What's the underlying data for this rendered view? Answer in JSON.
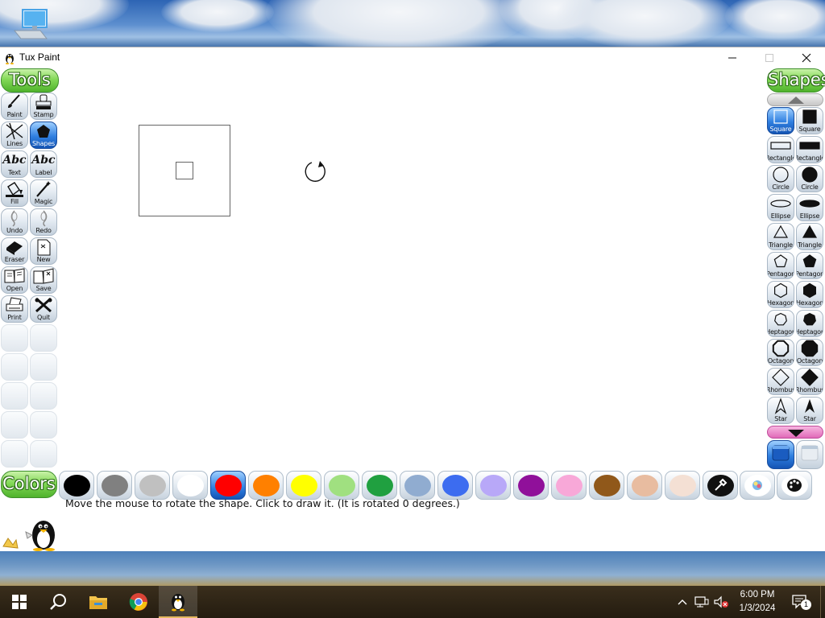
{
  "window": {
    "title": "Tux Paint",
    "minimize_glyph": "—",
    "maximize_glyph": "☐",
    "close_glyph": "✕"
  },
  "tools": {
    "header": "Tools",
    "items": [
      {
        "label": "Paint",
        "icon": "paintbrush-icon"
      },
      {
        "label": "Stamp",
        "icon": "stamp-icon"
      },
      {
        "label": "Lines",
        "icon": "lines-icon"
      },
      {
        "label": "Shapes",
        "icon": "shapes-icon",
        "selected": true
      },
      {
        "label": "Text",
        "icon": "text-icon",
        "glyph": "Abc"
      },
      {
        "label": "Label",
        "icon": "label-icon",
        "glyph": "Abc"
      },
      {
        "label": "Fill",
        "icon": "fill-icon"
      },
      {
        "label": "Magic",
        "icon": "magic-wand-icon"
      },
      {
        "label": "Undo",
        "icon": "undo-icon"
      },
      {
        "label": "Redo",
        "icon": "redo-icon"
      },
      {
        "label": "Eraser",
        "icon": "eraser-icon"
      },
      {
        "label": "New",
        "icon": "new-page-icon"
      },
      {
        "label": "Open",
        "icon": "open-icon"
      },
      {
        "label": "Save",
        "icon": "save-icon"
      },
      {
        "label": "Print",
        "icon": "print-icon"
      },
      {
        "label": "Quit",
        "icon": "quit-icon"
      }
    ]
  },
  "shapes": {
    "header": "Shapes",
    "items": [
      {
        "label": "Square",
        "icon": "square-outline-icon",
        "selected": true
      },
      {
        "label": "Square",
        "icon": "square-filled-icon"
      },
      {
        "label": "Rectangle",
        "icon": "rectangle-outline-icon"
      },
      {
        "label": "Rectangle",
        "icon": "rectangle-filled-icon"
      },
      {
        "label": "Circle",
        "icon": "circle-outline-icon"
      },
      {
        "label": "Circle",
        "icon": "circle-filled-icon"
      },
      {
        "label": "Ellipse",
        "icon": "ellipse-outline-icon"
      },
      {
        "label": "Ellipse",
        "icon": "ellipse-filled-icon"
      },
      {
        "label": "Triangle",
        "icon": "triangle-outline-icon"
      },
      {
        "label": "Triangle",
        "icon": "triangle-filled-icon"
      },
      {
        "label": "Pentagon",
        "icon": "pentagon-outline-icon"
      },
      {
        "label": "Pentagon",
        "icon": "pentagon-filled-icon"
      },
      {
        "label": "Hexagon",
        "icon": "hexagon-outline-icon"
      },
      {
        "label": "Hexagon",
        "icon": "hexagon-filled-icon"
      },
      {
        "label": "Heptagon",
        "icon": "heptagon-outline-icon"
      },
      {
        "label": "Heptagon",
        "icon": "heptagon-filled-icon"
      },
      {
        "label": "Octagon",
        "icon": "octagon-outline-icon"
      },
      {
        "label": "Octagon",
        "icon": "octagon-filled-icon"
      },
      {
        "label": "Rhombus",
        "icon": "rhombus-outline-icon"
      },
      {
        "label": "Rhombus",
        "icon": "rhombus-filled-icon"
      },
      {
        "label": "Star",
        "icon": "star-outline-icon"
      },
      {
        "label": "Star",
        "icon": "star-filled-icon"
      }
    ]
  },
  "colors": {
    "header": "Colors",
    "swatches": [
      {
        "name": "black",
        "hex": "#000000"
      },
      {
        "name": "dark-gray",
        "hex": "#808080"
      },
      {
        "name": "light-gray",
        "hex": "#c0c0c0"
      },
      {
        "name": "white",
        "hex": "#ffffff"
      },
      {
        "name": "red",
        "hex": "#ff0000",
        "selected": true
      },
      {
        "name": "orange",
        "hex": "#ff8000"
      },
      {
        "name": "yellow",
        "hex": "#ffff00"
      },
      {
        "name": "light-green",
        "hex": "#a0e080"
      },
      {
        "name": "dark-green",
        "hex": "#20a040"
      },
      {
        "name": "sky-blue",
        "hex": "#90acd0"
      },
      {
        "name": "blue",
        "hex": "#3c6cf0"
      },
      {
        "name": "lavender",
        "hex": "#b8a8f8"
      },
      {
        "name": "purple",
        "hex": "#90109a"
      },
      {
        "name": "pink",
        "hex": "#f8a8d8"
      },
      {
        "name": "brown",
        "hex": "#90581a"
      },
      {
        "name": "tan",
        "hex": "#e8bca0"
      },
      {
        "name": "beige",
        "hex": "#f4e0d4"
      }
    ]
  },
  "status_message": "Move the mouse to rotate the shape. Click to draw it. (It is rotated 0 degrees.)",
  "taskbar": {
    "time": "6:00 PM",
    "date": "1/3/2024",
    "notification_count": "1"
  }
}
